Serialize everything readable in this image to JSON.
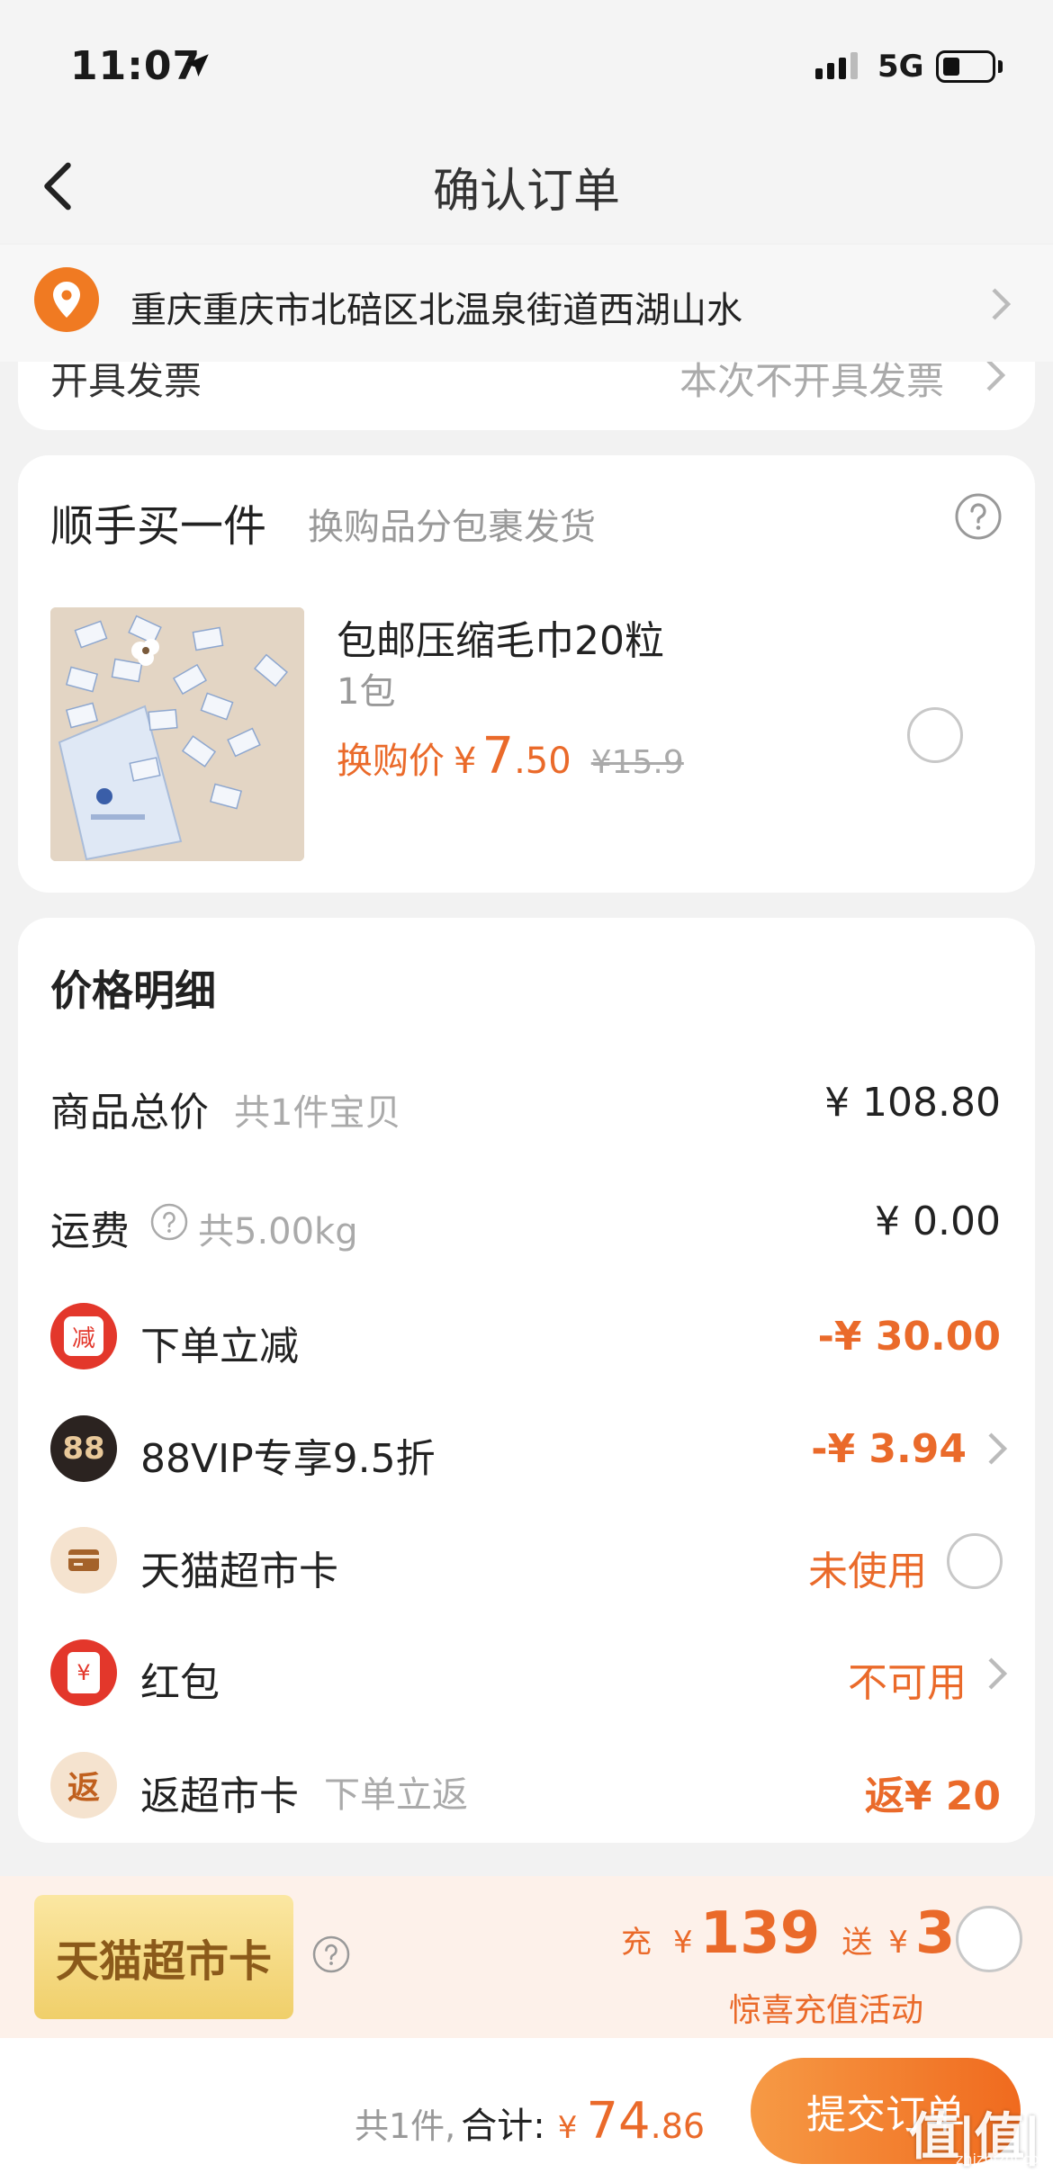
{
  "status_bar": {
    "time": "11:07",
    "network": "5G"
  },
  "nav": {
    "title": "确认订单"
  },
  "address": {
    "text": "重庆重庆市北碚区北温泉街道西湖山水"
  },
  "invoice": {
    "label": "开具发票",
    "value": "本次不开具发票"
  },
  "addon": {
    "title": "顺手买一件",
    "subtitle": "换购品分包裹发货",
    "product": {
      "name": "包邮压缩毛巾20粒",
      "qty": "1包",
      "price_label": "换购价",
      "currency": "¥",
      "price_int": "7",
      "price_dec": ".50",
      "old_price": "¥15.9"
    }
  },
  "detail": {
    "title": "价格明细",
    "total": {
      "label": "商品总价",
      "sub": "共1件宝贝",
      "value": "¥ 108.80"
    },
    "shipping": {
      "label": "运费",
      "sub": "共5.00kg",
      "value": "¥ 0.00"
    },
    "discount": {
      "icon_text": "减",
      "label": "下单立减",
      "value": "-¥ 30.00"
    },
    "vip": {
      "icon_text": "88",
      "label": "88VIP专享9.5折",
      "value": "-¥ 3.94"
    },
    "tmcard": {
      "label": "天猫超市卡",
      "value": "未使用"
    },
    "redpacket": {
      "icon_text": "¥",
      "label": "红包",
      "value": "不可用"
    },
    "rebate": {
      "icon_text": "返",
      "label": "返超市卡",
      "sub": "下单立返",
      "value": "返¥ 20"
    }
  },
  "tmall_card_promo": {
    "badge": "天猫超市卡",
    "charge_label": "充",
    "currency": "¥",
    "charge_amount": "139",
    "gift_label": "送",
    "gift_amount": "3",
    "activity": "惊喜充值活动"
  },
  "footer": {
    "count": "共1件,",
    "total_label": "合计:",
    "currency": "¥",
    "total_int": "74",
    "total_dec": ".86",
    "submit": "提交订单"
  },
  "watermark": {
    "main": "值|值|值",
    "sub": "zhizhizhi.com"
  },
  "colors": {
    "accent": "#ea6a2a",
    "red": "#e3372b",
    "gold": "#f0cf6a"
  }
}
